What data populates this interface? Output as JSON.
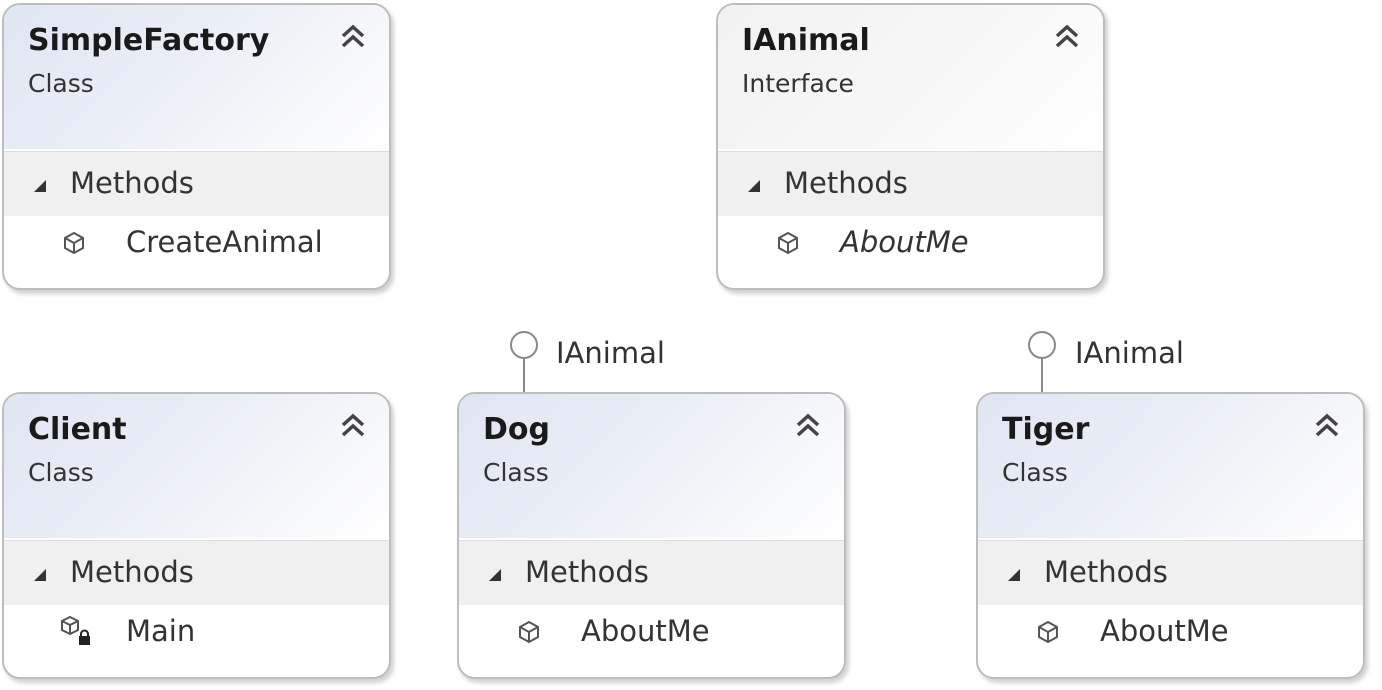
{
  "boxes": {
    "simplefactory": {
      "name": "SimpleFactory",
      "kind": "Class",
      "section": "Methods",
      "member": "CreateAnimal"
    },
    "ianimal": {
      "name": "IAnimal",
      "kind": "Interface",
      "section": "Methods",
      "member": "AboutMe"
    },
    "client": {
      "name": "Client",
      "kind": "Class",
      "section": "Methods",
      "member": "Main"
    },
    "dog": {
      "name": "Dog",
      "kind": "Class",
      "section": "Methods",
      "member": "AboutMe",
      "implements": "IAnimal"
    },
    "tiger": {
      "name": "Tiger",
      "kind": "Class",
      "section": "Methods",
      "member": "AboutMe",
      "implements": "IAnimal"
    }
  },
  "icons": {
    "collapse": "double-chevron-up-icon",
    "section_toggle": "triangle-expanded-icon",
    "method": "method-cube-icon",
    "private_method": "method-cube-lock-icon",
    "interface_lollipop": "interface-lollipop-icon"
  }
}
